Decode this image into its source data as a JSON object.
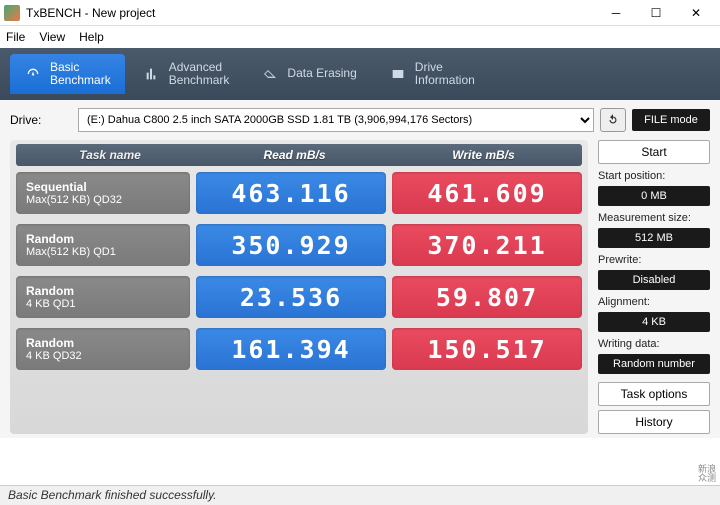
{
  "window": {
    "title": "TxBENCH - New project"
  },
  "menu": {
    "file": "File",
    "view": "View",
    "help": "Help"
  },
  "tabs": {
    "basic": "Basic\nBenchmark",
    "advanced": "Advanced\nBenchmark",
    "erasing": "Data Erasing",
    "info": "Drive\nInformation"
  },
  "drive": {
    "label": "Drive:",
    "selected": "(E:) Dahua C800 2.5 inch SATA 2000GB SSD   1.81 TB (3,906,994,176 Sectors)",
    "filemode": "FILE mode"
  },
  "headers": {
    "task": "Task name",
    "read": "Read mB/s",
    "write": "Write mB/s"
  },
  "rows": [
    {
      "name1": "Sequential",
      "name2": "Max(512 KB) QD32",
      "read": "463.116",
      "write": "461.609"
    },
    {
      "name1": "Random",
      "name2": "Max(512 KB) QD1",
      "read": "350.929",
      "write": "370.211"
    },
    {
      "name1": "Random",
      "name2": "4 KB QD1",
      "read": "23.536",
      "write": "59.807"
    },
    {
      "name1": "Random",
      "name2": "4 KB QD32",
      "read": "161.394",
      "write": "150.517"
    }
  ],
  "side": {
    "start": "Start",
    "startpos_l": "Start position:",
    "startpos_v": "0 MB",
    "msize_l": "Measurement size:",
    "msize_v": "512 MB",
    "prewrite_l": "Prewrite:",
    "prewrite_v": "Disabled",
    "align_l": "Alignment:",
    "align_v": "4 KB",
    "wdata_l": "Writing data:",
    "wdata_v": "Random number",
    "taskopt": "Task options",
    "history": "History"
  },
  "status": "Basic Benchmark finished successfully.",
  "watermark": "新浪\n众测"
}
